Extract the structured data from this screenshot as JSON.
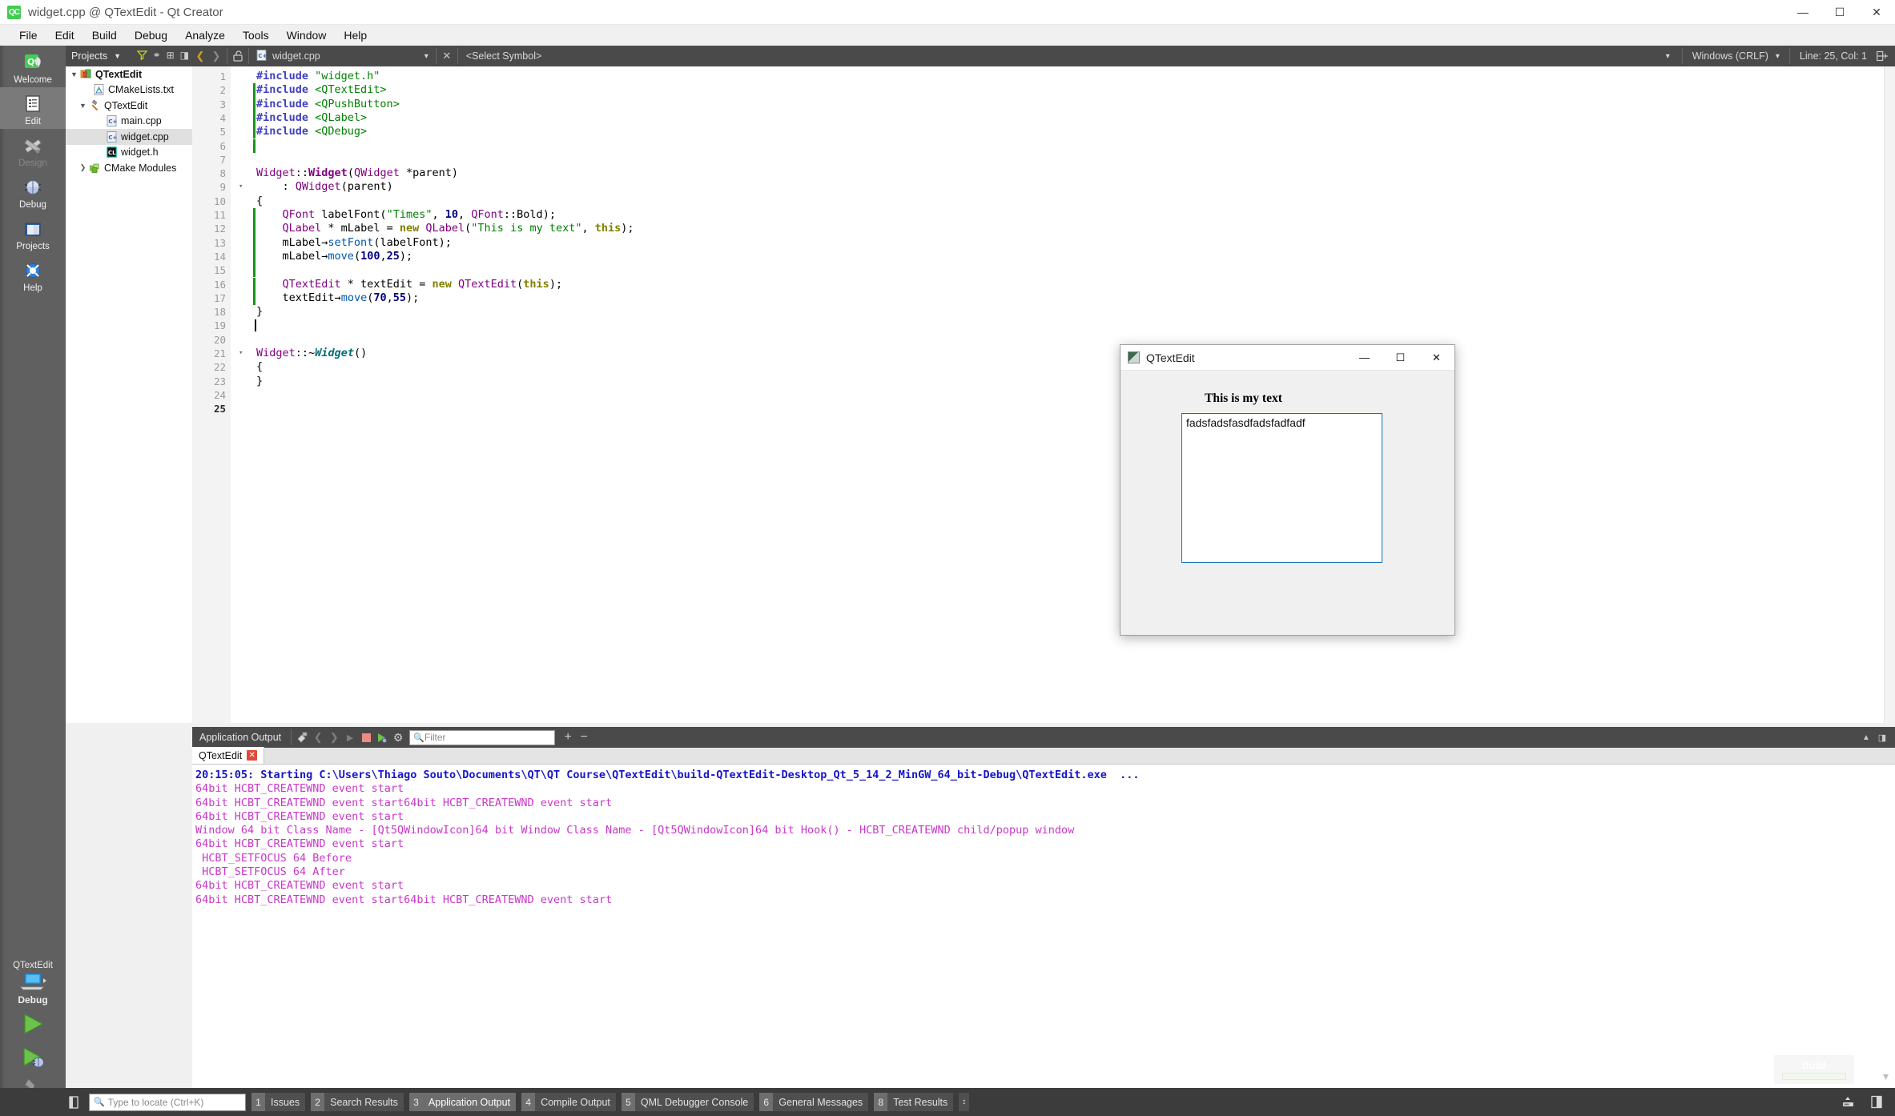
{
  "window": {
    "title": "widget.cpp @ QTextEdit - Qt Creator",
    "logo_text": "QC",
    "minimize": "—",
    "maximize": "☐",
    "close": "✕"
  },
  "menubar": {
    "items": [
      {
        "label": "File"
      },
      {
        "label": "Edit"
      },
      {
        "label": "Build"
      },
      {
        "label": "Debug"
      },
      {
        "label": "Analyze"
      },
      {
        "label": "Tools"
      },
      {
        "label": "Window"
      },
      {
        "label": "Help"
      }
    ]
  },
  "modebar": {
    "modes": [
      {
        "label": "Welcome",
        "icon": "qt-logo-icon",
        "state": "normal"
      },
      {
        "label": "Edit",
        "icon": "document-lines-icon",
        "state": "selected"
      },
      {
        "label": "Design",
        "icon": "ruler-brush-icon",
        "state": "disabled"
      },
      {
        "label": "Debug",
        "icon": "bug-icon",
        "state": "normal"
      },
      {
        "label": "Projects",
        "icon": "folder-icon",
        "state": "normal"
      },
      {
        "label": "Help",
        "icon": "lifebuoy-icon",
        "state": "normal"
      }
    ],
    "kit": {
      "project": "QTextEdit",
      "build_config": "Debug",
      "icon": "computer-icon"
    },
    "actions": [
      {
        "label": "Run",
        "icon": "run-green-play-icon"
      },
      {
        "label": "Start Debugging",
        "icon": "debug-play-bug-icon"
      },
      {
        "label": "Build",
        "icon": "hammer-icon"
      }
    ]
  },
  "projects_pane": {
    "title": "Projects",
    "toolbar": [
      {
        "name": "filter-icon",
        "glyph": "▼"
      },
      {
        "name": "link-icon",
        "glyph": "⚭"
      },
      {
        "name": "split-add-icon",
        "glyph": "⊞"
      },
      {
        "name": "close-pane-icon",
        "glyph": "◨"
      }
    ],
    "tree": [
      {
        "label": "QTextEdit",
        "depth": 0,
        "expander": "▼",
        "icon": "project-icon",
        "bold": true,
        "selected": false
      },
      {
        "label": "CMakeLists.txt",
        "depth": 1,
        "expander": "",
        "icon": "cmake-file-icon",
        "bold": false,
        "selected": false
      },
      {
        "label": "QTextEdit",
        "depth": 1,
        "expander": "▼",
        "icon": "hammer-target-icon",
        "bold": false,
        "selected": false
      },
      {
        "label": "main.cpp",
        "depth": 2,
        "expander": "",
        "icon": "cpp-file-icon",
        "bold": false,
        "selected": false
      },
      {
        "label": "widget.cpp",
        "depth": 2,
        "expander": "",
        "icon": "cpp-file-icon",
        "bold": false,
        "selected": true
      },
      {
        "label": "widget.h",
        "depth": 2,
        "expander": "",
        "icon": "header-file-icon",
        "bold": false,
        "selected": false
      },
      {
        "label": "CMake Modules",
        "depth": 1,
        "expander": "❯",
        "icon": "cmake-modules-icon",
        "bold": false,
        "selected": false
      }
    ]
  },
  "editor_toolbar": {
    "back": "❮",
    "forward": "❯",
    "lock_icon": "unlocked-padlock-icon",
    "file_icon": "cpp-file-icon",
    "filename": "widget.cpp",
    "dropdown": "▾",
    "close": "✕",
    "symbol_selector": "<Select Symbol>",
    "symbol_dropdown": "▾",
    "line_ending": "Windows (CRLF)",
    "line_ending_dropdown": "▾",
    "cursor_position": "Line: 25, Col: 1",
    "split_icon": "split-editor-icon"
  },
  "editor": {
    "current_line": 25,
    "total_lines": 25,
    "lines": [
      {
        "n": 1,
        "changed": false,
        "fold": "",
        "tokens": [
          {
            "t": "#include ",
            "c": "pp"
          },
          {
            "t": "\"widget.h\"",
            "c": "str"
          }
        ]
      },
      {
        "n": 2,
        "changed": true,
        "fold": "",
        "tokens": [
          {
            "t": "#include ",
            "c": "pp"
          },
          {
            "t": "<QTextEdit>",
            "c": "str"
          }
        ]
      },
      {
        "n": 3,
        "changed": true,
        "fold": "",
        "tokens": [
          {
            "t": "#include ",
            "c": "pp"
          },
          {
            "t": "<QPushButton>",
            "c": "str"
          }
        ]
      },
      {
        "n": 4,
        "changed": true,
        "fold": "",
        "tokens": [
          {
            "t": "#include ",
            "c": "pp"
          },
          {
            "t": "<QLabel>",
            "c": "str"
          }
        ]
      },
      {
        "n": 5,
        "changed": true,
        "fold": "",
        "tokens": [
          {
            "t": "#include ",
            "c": "pp"
          },
          {
            "t": "<QDebug>",
            "c": "str"
          }
        ]
      },
      {
        "n": 6,
        "changed": true,
        "fold": "",
        "tokens": []
      },
      {
        "n": 7,
        "changed": false,
        "fold": "",
        "tokens": []
      },
      {
        "n": 8,
        "changed": false,
        "fold": "",
        "tokens": [
          {
            "t": "Widget",
            "c": "cls"
          },
          {
            "t": "::",
            "c": "op"
          },
          {
            "t": "Widget",
            "c": "cls bd"
          },
          {
            "t": "(",
            "c": "op"
          },
          {
            "t": "QWidget",
            "c": "cls"
          },
          {
            "t": " *parent)",
            "c": "op"
          }
        ]
      },
      {
        "n": 9,
        "changed": false,
        "fold": "▾",
        "tokens": [
          {
            "t": "    : ",
            "c": "op"
          },
          {
            "t": "QWidget",
            "c": "cls"
          },
          {
            "t": "(parent)",
            "c": "op"
          }
        ]
      },
      {
        "n": 10,
        "changed": false,
        "fold": "",
        "tokens": [
          {
            "t": "{",
            "c": "op"
          }
        ]
      },
      {
        "n": 11,
        "changed": true,
        "fold": "",
        "tokens": [
          {
            "t": "    ",
            "c": "op"
          },
          {
            "t": "QFont",
            "c": "cls"
          },
          {
            "t": " labelFont(",
            "c": "op"
          },
          {
            "t": "\"Times\"",
            "c": "str"
          },
          {
            "t": ", ",
            "c": "op"
          },
          {
            "t": "10",
            "c": "num"
          },
          {
            "t": ", ",
            "c": "op"
          },
          {
            "t": "QFont",
            "c": "cls"
          },
          {
            "t": "::",
            "c": "op"
          },
          {
            "t": "Bold",
            "c": "op"
          },
          {
            "t": ");",
            "c": "op"
          }
        ]
      },
      {
        "n": 12,
        "changed": true,
        "fold": "",
        "tokens": [
          {
            "t": "    ",
            "c": "op"
          },
          {
            "t": "QLabel",
            "c": "cls"
          },
          {
            "t": " * mLabel = ",
            "c": "op"
          },
          {
            "t": "new",
            "c": "kw"
          },
          {
            "t": " ",
            "c": "op"
          },
          {
            "t": "QLabel",
            "c": "cls"
          },
          {
            "t": "(",
            "c": "op"
          },
          {
            "t": "\"This is my text\"",
            "c": "str"
          },
          {
            "t": ", ",
            "c": "op"
          },
          {
            "t": "this",
            "c": "kw"
          },
          {
            "t": ");",
            "c": "op"
          }
        ]
      },
      {
        "n": 13,
        "changed": true,
        "fold": "",
        "tokens": [
          {
            "t": "    mLabel",
            "c": "op"
          },
          {
            "t": "→",
            "c": "op"
          },
          {
            "t": "setFont",
            "c": "fn"
          },
          {
            "t": "(labelFont);",
            "c": "op"
          }
        ]
      },
      {
        "n": 14,
        "changed": true,
        "fold": "",
        "tokens": [
          {
            "t": "    mLabel",
            "c": "op"
          },
          {
            "t": "→",
            "c": "op"
          },
          {
            "t": "move",
            "c": "fn"
          },
          {
            "t": "(",
            "c": "op"
          },
          {
            "t": "100",
            "c": "num"
          },
          {
            "t": ",",
            "c": "op"
          },
          {
            "t": "25",
            "c": "num"
          },
          {
            "t": ");",
            "c": "op"
          }
        ]
      },
      {
        "n": 15,
        "changed": true,
        "fold": "",
        "tokens": []
      },
      {
        "n": 16,
        "changed": true,
        "fold": "",
        "tokens": [
          {
            "t": "    ",
            "c": "op"
          },
          {
            "t": "QTextEdit",
            "c": "cls"
          },
          {
            "t": " * textEdit = ",
            "c": "op"
          },
          {
            "t": "new",
            "c": "kw"
          },
          {
            "t": " ",
            "c": "op"
          },
          {
            "t": "QTextEdit",
            "c": "cls"
          },
          {
            "t": "(",
            "c": "op"
          },
          {
            "t": "this",
            "c": "kw"
          },
          {
            "t": ");",
            "c": "op"
          }
        ]
      },
      {
        "n": 17,
        "changed": true,
        "fold": "",
        "tokens": [
          {
            "t": "    textEdit",
            "c": "op"
          },
          {
            "t": "→",
            "c": "op"
          },
          {
            "t": "move",
            "c": "fn"
          },
          {
            "t": "(",
            "c": "op"
          },
          {
            "t": "70",
            "c": "num"
          },
          {
            "t": ",",
            "c": "op"
          },
          {
            "t": "55",
            "c": "num"
          },
          {
            "t": ");",
            "c": "op"
          }
        ]
      },
      {
        "n": 18,
        "changed": false,
        "fold": "",
        "tokens": [
          {
            "t": "}",
            "c": "op"
          }
        ]
      },
      {
        "n": 19,
        "changed": false,
        "fold": "",
        "tokens": []
      },
      {
        "n": 20,
        "changed": false,
        "fold": "",
        "tokens": []
      },
      {
        "n": 21,
        "changed": false,
        "fold": "▾",
        "tokens": [
          {
            "t": "Widget",
            "c": "cls"
          },
          {
            "t": "::",
            "c": "op"
          },
          {
            "t": "~",
            "c": "op"
          },
          {
            "t": "Widget",
            "c": "dtor"
          },
          {
            "t": "()",
            "c": "op"
          }
        ]
      },
      {
        "n": 22,
        "changed": false,
        "fold": "",
        "tokens": [
          {
            "t": "{",
            "c": "op"
          }
        ]
      },
      {
        "n": 23,
        "changed": false,
        "fold": "",
        "tokens": [
          {
            "t": "}",
            "c": "op"
          }
        ]
      },
      {
        "n": 24,
        "changed": false,
        "fold": "",
        "tokens": []
      },
      {
        "n": 25,
        "changed": false,
        "fold": "",
        "tokens": []
      }
    ]
  },
  "output_pane": {
    "title": "Application Output",
    "toolbar": [
      {
        "name": "clear-output-icon",
        "glyph": "⌦"
      },
      {
        "name": "prev-item-icon",
        "glyph": "❮"
      },
      {
        "name": "next-item-icon",
        "glyph": "❯"
      },
      {
        "name": "run-icon",
        "glyph": "▶"
      },
      {
        "name": "stop-icon",
        "glyph": "■"
      },
      {
        "name": "attach-debugger-icon",
        "glyph": "▶"
      },
      {
        "name": "settings-gear-icon",
        "glyph": "⚙"
      }
    ],
    "filter_placeholder": "Filter",
    "zoom_in": "+",
    "zoom_out": "−",
    "maximize_icon": "▲",
    "close_icon": "◨",
    "tabs": [
      {
        "label": "QTextEdit",
        "close": "✕",
        "active": true
      }
    ],
    "lines": [
      {
        "text": "20:15:05: Starting C:\\Users\\Thiago Souto\\Documents\\QT\\QT Course\\QTextEdit\\build-QTextEdit-Desktop_Qt_5_14_2_MinGW_64_bit-Debug\\QTextEdit.exe  ...",
        "kind": "start"
      },
      {
        "text": "64bit HCBT_CREATEWND event start",
        "kind": "msg"
      },
      {
        "text": "64bit HCBT_CREATEWND event start64bit HCBT_CREATEWND event start",
        "kind": "msg"
      },
      {
        "text": "64bit HCBT_CREATEWND event start",
        "kind": "msg"
      },
      {
        "text": "Window 64 bit Class Name - [Qt5QWindowIcon]64 bit Window Class Name - [Qt5QWindowIcon]64 bit Hook() - HCBT_CREATEWND child/popup window",
        "kind": "msg"
      },
      {
        "text": "64bit HCBT_CREATEWND event start",
        "kind": "msg"
      },
      {
        "text": " HCBT_SETFOCUS 64 Before",
        "kind": "msg"
      },
      {
        "text": " HCBT_SETFOCUS 64 After",
        "kind": "msg"
      },
      {
        "text": "64bit HCBT_CREATEWND event start",
        "kind": "msg"
      },
      {
        "text": "64bit HCBT_CREATEWND event start64bit HCBT_CREATEWND event start",
        "kind": "msg"
      }
    ]
  },
  "app_window": {
    "title": "QTextEdit",
    "minimize": "—",
    "maximize": "☐",
    "close": "✕",
    "label_text": "This is my text",
    "textedit_value": "fadsfadsfasdfadsfadfadf"
  },
  "statusbar": {
    "sidebar_toggle": "◧",
    "locator_placeholder": "Type to locate (Ctrl+K)",
    "items": [
      {
        "num": "1",
        "label": "Issues",
        "active": false
      },
      {
        "num": "2",
        "label": "Search Results",
        "active": false
      },
      {
        "num": "3",
        "label": "Application Output",
        "active": true
      },
      {
        "num": "4",
        "label": "Compile Output",
        "active": false
      },
      {
        "num": "5",
        "label": "QML Debugger Console",
        "active": false
      },
      {
        "num": "6",
        "label": "General Messages",
        "active": false
      },
      {
        "num": "8",
        "label": "Test Results",
        "active": false
      }
    ],
    "stepper": "↕",
    "progress_label": "Build"
  }
}
